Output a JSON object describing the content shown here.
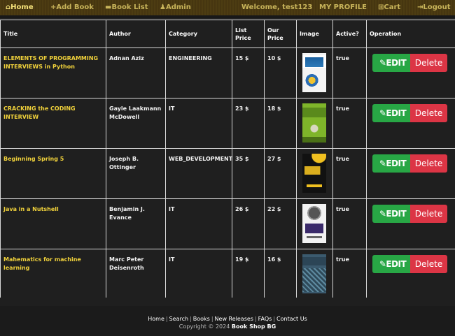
{
  "nav": {
    "home": "Home",
    "add_book": "+Add Book",
    "book_list": "Book List",
    "admin": "Admin",
    "welcome": "Welcome, test123",
    "profile": "MY PROFILE",
    "cart": "Cart",
    "logout": "Logout"
  },
  "table": {
    "headers": [
      "Title",
      "Author",
      "Category",
      "List Price",
      "Our Price",
      "Image",
      "Active?",
      "Operation"
    ],
    "rows": [
      {
        "title": "ELEMENTS OF PROGRAMMING INTERVIEWS in Python",
        "author": "Adnan Aziz",
        "category": "ENGINEERING",
        "list_price": "15 $",
        "our_price": "10 $",
        "active": "true"
      },
      {
        "title": "CRACKING the CODING INTERVIEW",
        "author": "Gayle Laakmann McDowell",
        "category": "IT",
        "list_price": "23 $",
        "our_price": "18 $",
        "active": "true"
      },
      {
        "title": "Beginning Spring 5",
        "author": "Joseph B. Ottinger",
        "category": "WEB_DEVELOPMENT",
        "list_price": "35 $",
        "our_price": "27 $",
        "active": "true"
      },
      {
        "title": "Java in a Nutshell",
        "author": "Benjamin J. Evance",
        "category": "IT",
        "list_price": "26 $",
        "our_price": "22 $",
        "active": "true"
      },
      {
        "title": "Mahematics for machine learning",
        "author": "Marc Peter Deisenroth",
        "category": "IT",
        "list_price": "19 $",
        "our_price": "16 $",
        "active": "true"
      }
    ],
    "edit_label": "EDIT",
    "delete_label": "Delete"
  },
  "footer": {
    "links": [
      "Home",
      "Search",
      "Books",
      "New Releases",
      "FAQs",
      "Contact Us"
    ],
    "copyright": "Copyright © 2024",
    "brand": "Book Shop BG"
  },
  "colors": {
    "accent_yellow": "#f1d23b",
    "edit_green": "#28a745",
    "delete_red": "#dc3545"
  }
}
